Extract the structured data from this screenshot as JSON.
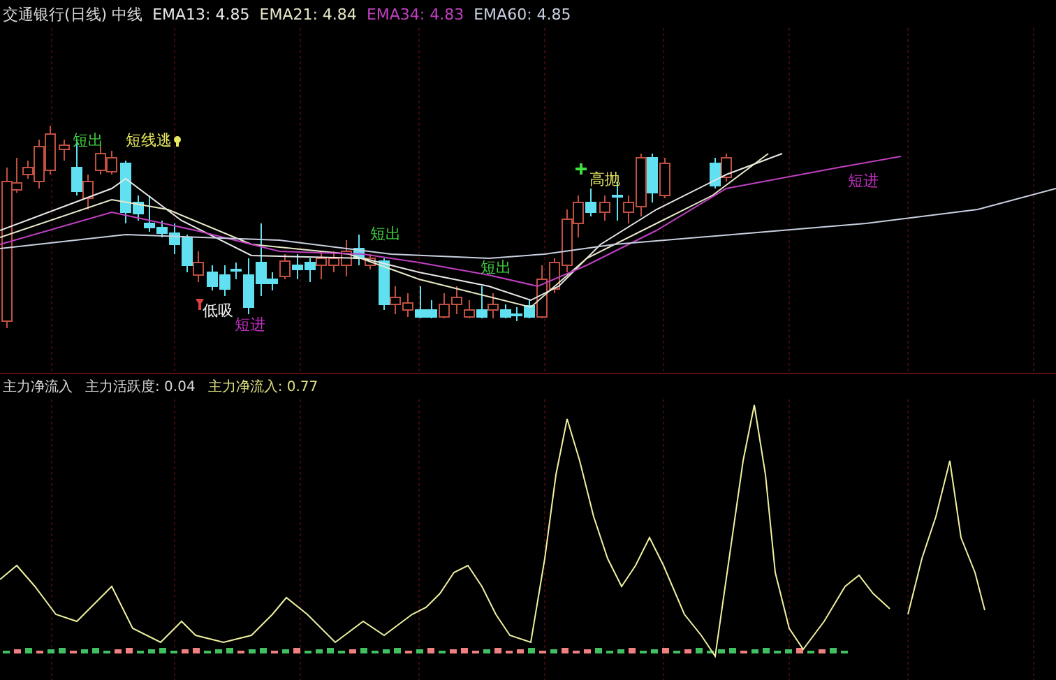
{
  "header": {
    "items": [
      {
        "text": "交通银行(日线) 中线",
        "color": "#d8d8d8"
      },
      {
        "text": "EMA13: 4.85",
        "color": "#e8e8e8"
      },
      {
        "text": "EMA21: 4.84",
        "color": "#e8e8c8"
      },
      {
        "text": "EMA34: 4.83",
        "color": "#c040c0"
      },
      {
        "text": "EMA60: 4.85",
        "color": "#c8d0e0"
      }
    ]
  },
  "signals": [
    {
      "text": "短出",
      "color": "#40d040"
    },
    {
      "text": "短线逃",
      "color": "#e8e860"
    },
    {
      "text": "低吸",
      "color": "#f0f0f0"
    },
    {
      "text": "短进",
      "color": "#c030c0"
    },
    {
      "text": "短出",
      "color": "#40d040"
    },
    {
      "text": "短出",
      "color": "#40d040"
    },
    {
      "text": "高抛",
      "color": "#e0e060"
    },
    {
      "text": "短进",
      "color": "#c030c0"
    }
  ],
  "lower_legend": {
    "items": [
      {
        "text": "主力净流入",
        "color": "#d8d8d8"
      },
      {
        "text": "主力活跃度: 0.04",
        "color": "#d8d8d8"
      },
      {
        "text": "主力净流入: 0.77",
        "color": "#e0e080"
      }
    ]
  }
}
